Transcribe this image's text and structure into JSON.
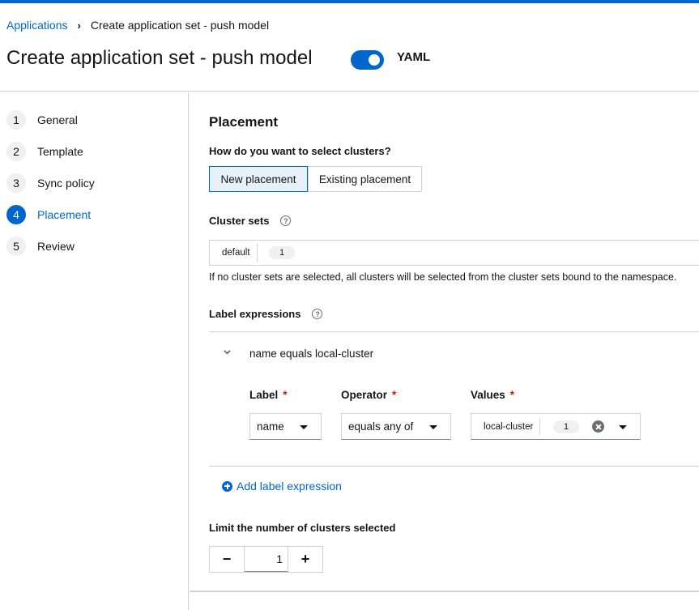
{
  "breadcrumb": {
    "parent": "Applications",
    "current": "Create application set - push model"
  },
  "header": {
    "title": "Create application set - push model",
    "yaml_toggle_label": "YAML",
    "yaml_toggle_on": true
  },
  "steps": [
    {
      "number": "1",
      "label": "General"
    },
    {
      "number": "2",
      "label": "Template"
    },
    {
      "number": "3",
      "label": "Sync policy"
    },
    {
      "number": "4",
      "label": "Placement",
      "active": true
    },
    {
      "number": "5",
      "label": "Review"
    }
  ],
  "placement": {
    "title": "Placement",
    "question": "How do you want to select clusters?",
    "options": [
      "New placement",
      "Existing placement"
    ],
    "selected_option": "New placement",
    "cluster_sets": {
      "label": "Cluster sets",
      "chip": "default",
      "count": "1",
      "helper": "If no cluster sets are selected, all clusters will be selected from the cluster sets bound to the namespace."
    },
    "label_expressions": {
      "label": "Label expressions",
      "expression_title": "name equals local-cluster",
      "label_field": {
        "label": "Label",
        "value": "name"
      },
      "operator_field": {
        "label": "Operator",
        "value": "equals any of"
      },
      "values_field": {
        "label": "Values",
        "chip": "local-cluster",
        "count": "1"
      },
      "required_mark": "*",
      "add_label": "Add label expression"
    },
    "limit": {
      "label": "Limit the number of clusters selected",
      "value": "1",
      "minus": "−",
      "plus": "+"
    }
  },
  "colors": {
    "accent": "#0066cc",
    "required": "#c9190b",
    "border": "#d2d2d2"
  },
  "icons": [
    "chevron-right-icon",
    "help-icon",
    "chevron-down-icon",
    "caret-down-icon",
    "times-circle-icon",
    "plus-circle-icon"
  ]
}
